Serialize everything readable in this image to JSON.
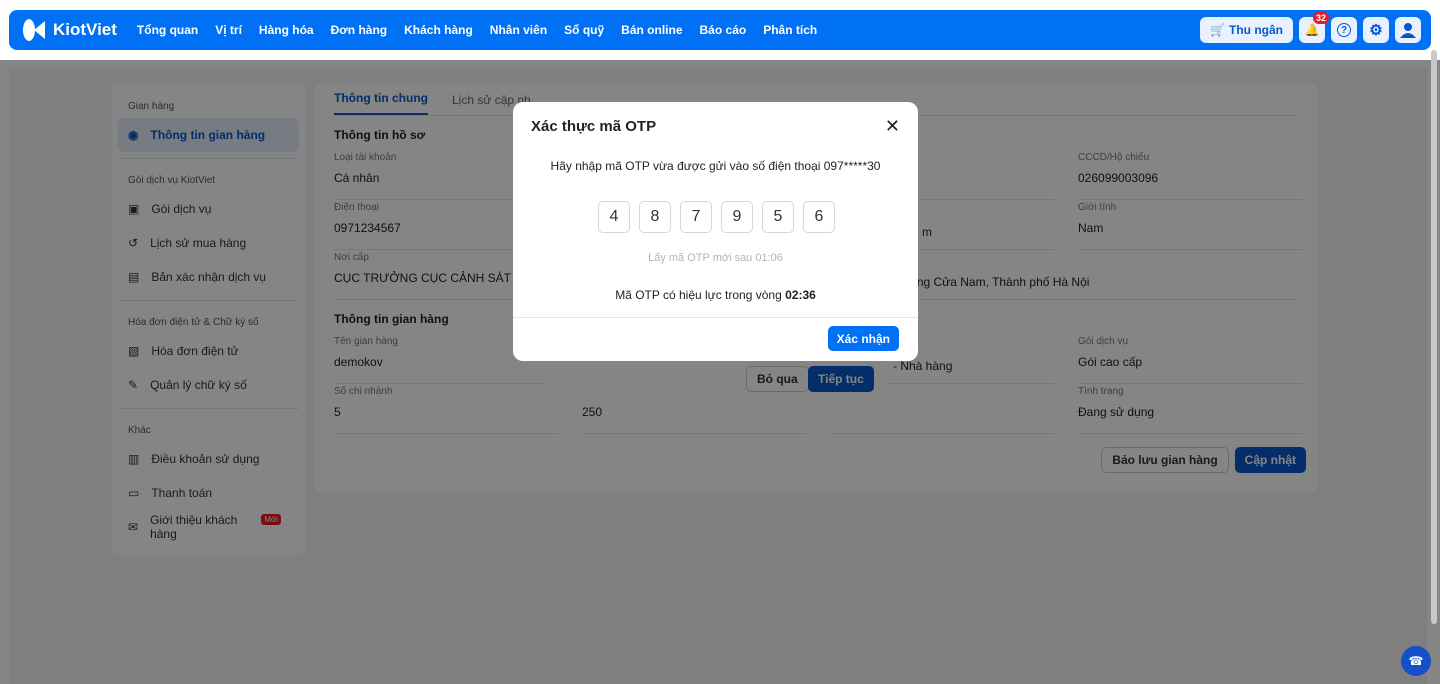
{
  "header": {
    "brand": "KiotViet",
    "nav": [
      "Tổng quan",
      "Vị trí",
      "Hàng hóa",
      "Đơn hàng",
      "Khách hàng",
      "Nhân viên",
      "Sổ quỹ",
      "Bán online",
      "Báo cáo",
      "Phân tích"
    ],
    "cashier": "Thu ngân",
    "notif_count": "32"
  },
  "sidebar": {
    "groups": [
      {
        "title": "Gian hàng",
        "items": [
          {
            "label": "Thông tin gian hàng",
            "icon": "user-circle-icon"
          }
        ]
      },
      {
        "title": "Gói dịch vụ KiotViet",
        "items": [
          {
            "label": "Gói dịch vụ",
            "icon": "store-icon"
          },
          {
            "label": "Lịch sử mua hàng",
            "icon": "history-icon"
          },
          {
            "label": "Bản xác nhận dịch vụ",
            "icon": "document-check-icon"
          }
        ]
      },
      {
        "title": "Hóa đơn điện tử & Chữ ký số",
        "items": [
          {
            "label": "Hóa đơn điện tử",
            "icon": "invoice-icon"
          },
          {
            "label": "Quản lý chữ ký số",
            "icon": "signature-icon"
          }
        ]
      },
      {
        "title": "Khác",
        "items": [
          {
            "label": "Điều khoản sử dụng",
            "icon": "terms-icon"
          },
          {
            "label": "Thanh toán",
            "icon": "wallet-icon"
          },
          {
            "label": "Giới thiệu khách hàng",
            "icon": "mail-icon",
            "badge": "Mới"
          }
        ]
      }
    ]
  },
  "main": {
    "tabs": [
      "Thông tin chung",
      "Lịch sử cập nh"
    ],
    "profile_title": "Thông tin hồ sơ",
    "account_type_label": "Loại tài khoản",
    "account_type": "Cá nhân",
    "id_label": "CCCD/Hộ chiếu",
    "id_value": "026099003096",
    "phone_label": "Điện thoại",
    "phone": "0971234567",
    "gender_label": "Giới tính",
    "gender": "Nam",
    "row2_fragment": "m",
    "issued_label": "Nơi cấp",
    "issued": "CỤC TRƯỞNG CỤC CẢNH SÁT QU",
    "address_fragment": "ờng Cửa Nam, Thành phố Hà Nội",
    "store_title": "Thông tin gian hàng",
    "store_name_label": "Tên gian hàng",
    "store_name": "demokov",
    "industry_fragment": "- Nhà hàng",
    "plan_label": "Gói dịch vụ",
    "plan": "Gói cao cấp",
    "branches_label": "Số chi nhánh",
    "branches": "5",
    "col2_value": "250",
    "status_label": "Tình trạng",
    "status": "Đang sử dụng",
    "backup_btn": "Bảo lưu gian hàng",
    "update_btn": "Cập nhật"
  },
  "under_dialog": {
    "skip": "Bỏ qua",
    "continue": "Tiếp tục"
  },
  "modal": {
    "title": "Xác thực mã OTP",
    "prompt": "Hãy nhập mã OTP vừa được gửi vào số điện thoại 097*****30",
    "otp": [
      "4",
      "8",
      "7",
      "9",
      "5",
      "6"
    ],
    "resend": "Lấy mã OTP mới sau 01:06",
    "validity_prefix": "Mã OTP có hiệu lực trong vòng ",
    "validity_time": "02:36",
    "confirm": "Xác nhận"
  }
}
